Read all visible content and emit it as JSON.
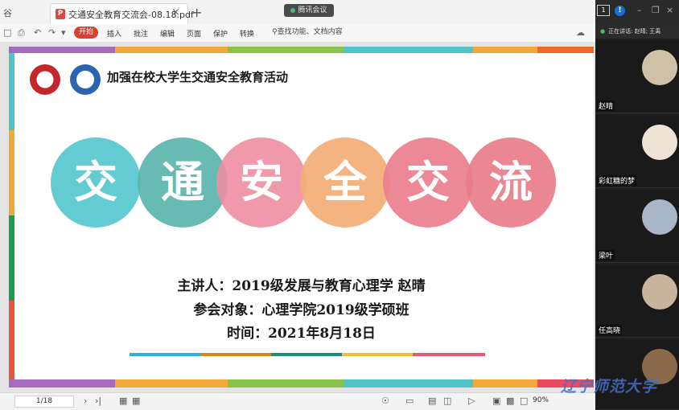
{
  "tabs": {
    "home_label": "谷",
    "doc_title": "交通安全教育交流会-08.18.pdf",
    "close_glyph": "×",
    "add_glyph": "+"
  },
  "meeting_pill": {
    "label": "腾讯会议"
  },
  "toolbar": {
    "start_label": "开始",
    "menus": [
      "插入",
      "批注",
      "编辑",
      "页面",
      "保护",
      "转换"
    ],
    "search_placeholder": "查找功能、文档内容"
  },
  "slide": {
    "heading": "加强在校大学生交通安全教育活动",
    "circles": [
      {
        "char": "交",
        "color": "#56c8cf"
      },
      {
        "char": "通",
        "color": "#5bb6ad"
      },
      {
        "char": "安",
        "color": "#ef8fa2"
      },
      {
        "char": "全",
        "color": "#f2ae78"
      },
      {
        "char": "交",
        "color": "#ec7f8f"
      },
      {
        "char": "流",
        "color": "#ea7d8a"
      }
    ],
    "speaker": "主讲人：2019级发展与教育心理学 赵晴",
    "audience": "参会对象：心理学院2019级学硕班",
    "date": "时间：2021年8月18日",
    "top_bar_colors": [
      "#a66bbf",
      "#f3a83b",
      "#89c44a",
      "#4fc3c7",
      "#f3a83b",
      "#ec6a2d"
    ],
    "bottom_bar_colors": [
      "#a66bbf",
      "#f3a83b",
      "#89c44a",
      "#4fc3c7",
      "#f3a83b",
      "#e84a5f"
    ],
    "underline_colors": [
      "#2bb3d4",
      "#d6861f",
      "#1f8c78",
      "#e8c23a",
      "#e45b78"
    ]
  },
  "statusbar": {
    "page": "1/18",
    "zoom": "90%"
  },
  "sidebar": {
    "speaking": "正在讲话: 赵晴; 王禹",
    "participants": [
      {
        "name": "赵晴",
        "color": "#cfc0a8"
      },
      {
        "name": "彩虹糖的梦",
        "color": "#efe3d6"
      },
      {
        "name": "梁叶",
        "color": "#a9b6c7"
      },
      {
        "name": "任高晓",
        "color": "#c9b49e"
      },
      {
        "name": "",
        "color": "#8a6a4a"
      }
    ]
  },
  "watermark": "辽宁师范大学"
}
